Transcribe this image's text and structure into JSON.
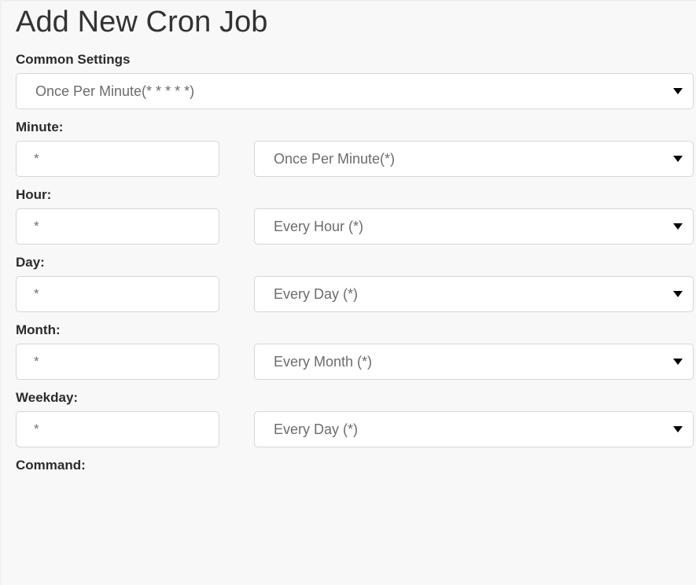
{
  "page": {
    "title": "Add New Cron Job"
  },
  "common_settings": {
    "label": "Common Settings",
    "selected": "Once Per Minute(* * * * *)"
  },
  "fields": [
    {
      "label": "Minute:",
      "value": "*",
      "selected": "Once Per Minute(*)"
    },
    {
      "label": "Hour:",
      "value": "*",
      "selected": "Every Hour (*)"
    },
    {
      "label": "Day:",
      "value": "*",
      "selected": "Every Day (*)"
    },
    {
      "label": "Month:",
      "value": "*",
      "selected": "Every Month (*)"
    },
    {
      "label": "Weekday:",
      "value": "*",
      "selected": "Every Day (*)"
    }
  ],
  "command": {
    "label": "Command:"
  },
  "icons": {
    "dropdown": "chevron-down-icon"
  },
  "colors": {
    "page_background": "#f8f8f8",
    "control_background": "#ffffff",
    "control_border": "#d6d6d6",
    "label_text": "#2b2b2b",
    "title_text": "#333333",
    "value_text": "#6c6c6c",
    "arrow": "#000000"
  }
}
